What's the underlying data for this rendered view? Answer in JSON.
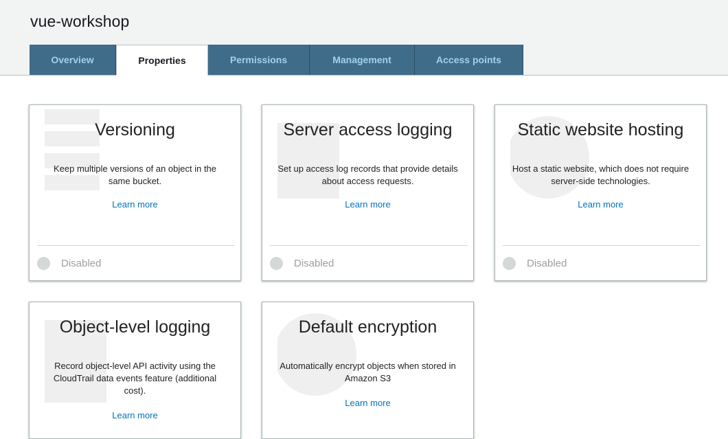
{
  "bucket": {
    "name": "vue-workshop"
  },
  "tabs": [
    {
      "label": "Overview",
      "active": false
    },
    {
      "label": "Properties",
      "active": true
    },
    {
      "label": "Permissions",
      "active": false
    },
    {
      "label": "Management",
      "active": false
    },
    {
      "label": "Access points",
      "active": false
    }
  ],
  "cards": [
    {
      "title": "Versioning",
      "description": "Keep multiple versions of an object in the same bucket.",
      "link": "Learn more",
      "status": "Disabled"
    },
    {
      "title": "Server access logging",
      "description": "Set up access log records that provide details about access requests.",
      "link": "Learn more",
      "status": "Disabled"
    },
    {
      "title": "Static website hosting",
      "description": "Host a static website, which does not require server-side technologies.",
      "link": "Learn more",
      "status": "Disabled"
    },
    {
      "title": "Object-level logging",
      "description": "Record object-level API activity using the CloudTrail data events feature (additional cost).",
      "link": "Learn more"
    },
    {
      "title": "Default encryption",
      "description": "Automatically encrypt objects when stored in Amazon S3",
      "link": "Learn more"
    }
  ],
  "colors": {
    "tab_bg": "#3f6c89",
    "tab_text": "#9fd2ee",
    "link": "#0073bb",
    "header_bg": "#f2f3f3"
  },
  "icons": [
    "status-dot-icon",
    "card-watermark-icon"
  ]
}
